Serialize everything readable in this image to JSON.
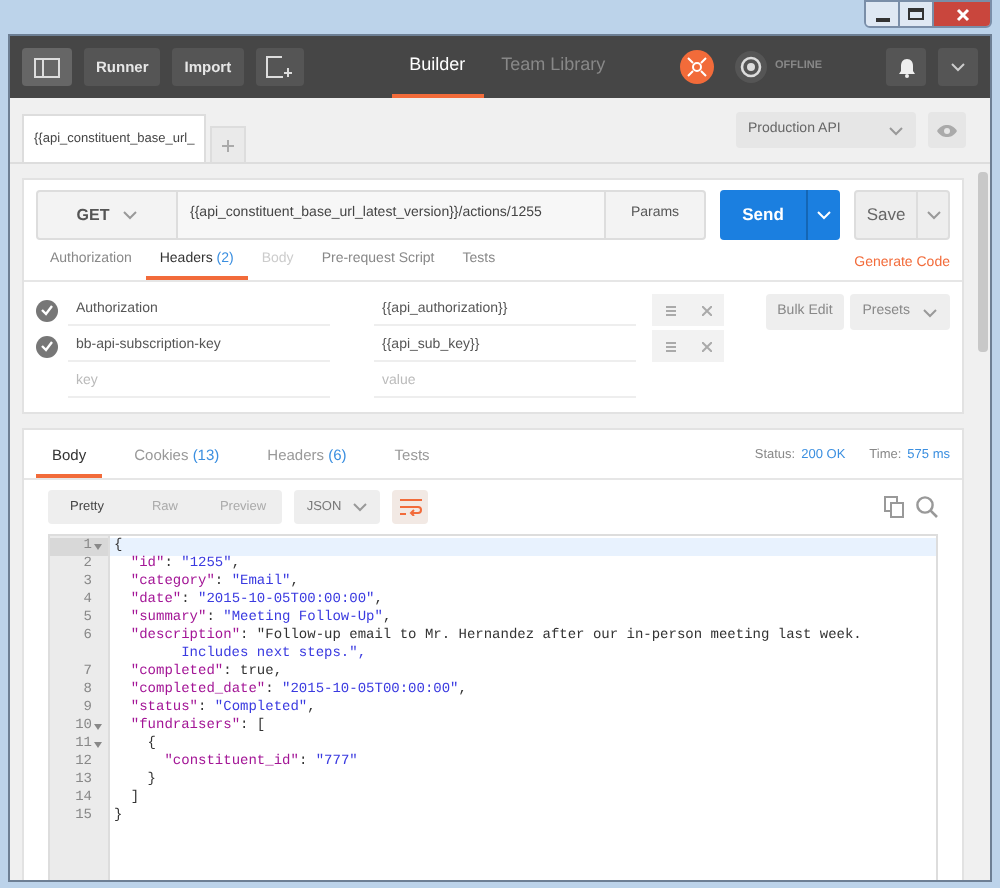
{
  "header": {
    "runner": "Runner",
    "import": "Import",
    "tabs": [
      {
        "label": "Builder",
        "selected": true
      },
      {
        "label": "Team Library",
        "selected": false
      }
    ],
    "status": "OFFLINE"
  },
  "request_tabs": [
    {
      "label": "{{api_constituent_base_url_",
      "selected": true
    }
  ],
  "environment": "Production API",
  "request": {
    "method": "GET",
    "url": "{{api_constituent_base_url_latest_version}}/actions/1255",
    "params": "Params",
    "send": "Send",
    "save": "Save"
  },
  "request_subtabs": [
    {
      "label": "Authorization",
      "selected": false,
      "disabled": false
    },
    {
      "label": "Headers",
      "count": "(2)",
      "selected": true,
      "disabled": false
    },
    {
      "label": "Body",
      "selected": false,
      "disabled": true
    },
    {
      "label": "Pre-request Script",
      "selected": false,
      "disabled": false
    },
    {
      "label": "Tests",
      "selected": false,
      "disabled": false
    }
  ],
  "generate_code": "Generate Code",
  "headers": [
    {
      "key": "Authorization",
      "value": "{{api_authorization}}",
      "checked": true
    },
    {
      "key": "bb-api-subscription-key",
      "value": "{{api_sub_key}}",
      "checked": true
    }
  ],
  "new_header": {
    "key_placeholder": "key",
    "value_placeholder": "value"
  },
  "bulk_edit": "Bulk Edit",
  "presets": "Presets",
  "response_tabs": [
    {
      "label": "Body",
      "selected": true
    },
    {
      "label": "Cookies",
      "count": "(13)",
      "selected": false
    },
    {
      "label": "Headers",
      "count": "(6)",
      "selected": false
    },
    {
      "label": "Tests",
      "selected": false
    }
  ],
  "status_label": "Status:",
  "status_value": "200 OK",
  "time_label": "Time:",
  "time_value": "575 ms",
  "view_modes": [
    {
      "label": "Pretty",
      "selected": true
    },
    {
      "label": "Raw",
      "selected": false
    },
    {
      "label": "Preview",
      "selected": false
    }
  ],
  "format": "JSON",
  "code": [
    {
      "number": "1",
      "text": "{",
      "foldable": true,
      "selected": true
    },
    {
      "number": "2",
      "text": "  \"id\": \"1255\",",
      "foldable": false,
      "selected": false
    },
    {
      "number": "3",
      "text": "  \"category\": \"Email\",",
      "foldable": false,
      "selected": false
    },
    {
      "number": "4",
      "text": "  \"date\": \"2015-10-05T00:00:00\",",
      "foldable": false,
      "selected": false
    },
    {
      "number": "5",
      "text": "  \"summary\": \"Meeting Follow-Up\",",
      "foldable": false,
      "selected": false
    },
    {
      "number": "6",
      "text": "  \"description\": \"Follow-up email to Mr. Hernandez after our in-person meeting last week.",
      "wrap": "Includes next steps.\",",
      "foldable": false,
      "selected": false
    },
    {
      "number": "7",
      "text": "  \"completed\": true,",
      "foldable": false,
      "selected": false
    },
    {
      "number": "8",
      "text": "  \"completed_date\": \"2015-10-05T00:00:00\",",
      "foldable": false,
      "selected": false
    },
    {
      "number": "9",
      "text": "  \"status\": \"Completed\",",
      "foldable": false,
      "selected": false
    },
    {
      "number": "10",
      "text": "  \"fundraisers\": [",
      "foldable": true,
      "selected": false
    },
    {
      "number": "11",
      "text": "    {",
      "foldable": true,
      "selected": false
    },
    {
      "number": "12",
      "text": "      \"constituent_id\": \"777\"",
      "foldable": false,
      "selected": false
    },
    {
      "number": "13",
      "text": "    }",
      "foldable": false,
      "selected": false
    },
    {
      "number": "14",
      "text": "  ]",
      "foldable": false,
      "selected": false
    },
    {
      "number": "15",
      "text": "}",
      "foldable": false,
      "selected": false
    }
  ]
}
